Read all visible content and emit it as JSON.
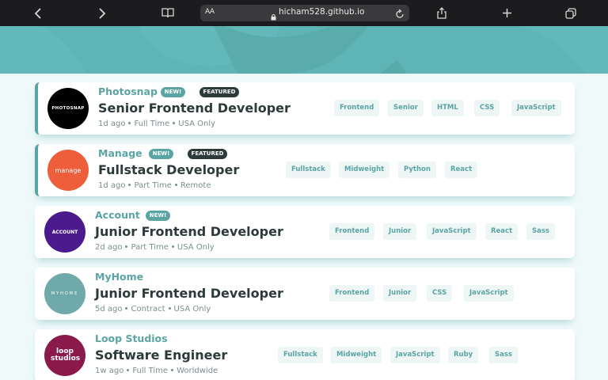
{
  "browser": {
    "text_size_label": "AA",
    "url": "hicham528.github.io",
    "icons": [
      "back-icon",
      "forward-icon",
      "reader-icon",
      "lock-icon",
      "reload-icon",
      "share-icon",
      "new-tab-icon",
      "tabs-icon"
    ]
  },
  "colors": {
    "primary": "#5ba4a4",
    "dark": "#2c3a3a",
    "tag_bg": "#eef6f6",
    "page_bg": "#eff9fa",
    "banner": "#5fb4b5"
  },
  "jobs": [
    {
      "company": "Photosnap",
      "logo_text": "PHOTOSNAP",
      "logo_color": "#000000",
      "new_label": "NEW!",
      "featured_label": "FEATURED",
      "position": "Senior Frontend Developer",
      "posted": "1d ago",
      "contract": "Full Time",
      "location": "USA Only",
      "tags": [
        "Frontend",
        "Senior",
        "HTML",
        "CSS",
        "JavaScript"
      ]
    },
    {
      "company": "Manage",
      "logo_text": "manage",
      "logo_color": "#ee5e3b",
      "new_label": "NEW!",
      "featured_label": "FEATURED",
      "position": "Fullstack Developer",
      "posted": "1d ago",
      "contract": "Part Time",
      "location": "Remote",
      "tags": [
        "Fullstack",
        "Midweight",
        "Python",
        "React"
      ]
    },
    {
      "company": "Account",
      "logo_text": "ACCOUNT",
      "logo_color": "#4b1a8c",
      "new_label": "NEW!",
      "position": "Junior Frontend Developer",
      "posted": "2d ago",
      "contract": "Part Time",
      "location": "USA Only",
      "tags": [
        "Frontend",
        "Junior",
        "JavaScript",
        "React",
        "Sass"
      ]
    },
    {
      "company": "MyHome",
      "logo_text": "MYHOME",
      "logo_color": "#6fa9a9",
      "position": "Junior Frontend Developer",
      "posted": "5d ago",
      "contract": "Contract",
      "location": "USA Only",
      "tags": [
        "Frontend",
        "Junior",
        "CSS",
        "JavaScript"
      ]
    },
    {
      "company": "Loop Studios",
      "logo_text": "loop studios",
      "logo_color": "#8a1a4c",
      "position": "Software Engineer",
      "posted": "1w ago",
      "contract": "Full Time",
      "location": "Worldwide",
      "tags": [
        "Fullstack",
        "Midweight",
        "JavaScript",
        "Ruby",
        "Sass"
      ]
    }
  ]
}
